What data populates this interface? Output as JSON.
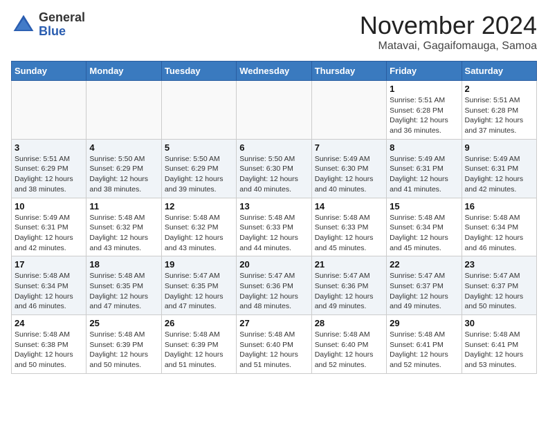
{
  "header": {
    "logo_line1": "General",
    "logo_line2": "Blue",
    "month": "November 2024",
    "location": "Matavai, Gagaifomauga, Samoa"
  },
  "days_of_week": [
    "Sunday",
    "Monday",
    "Tuesday",
    "Wednesday",
    "Thursday",
    "Friday",
    "Saturday"
  ],
  "weeks": [
    [
      {
        "day": "",
        "info": ""
      },
      {
        "day": "",
        "info": ""
      },
      {
        "day": "",
        "info": ""
      },
      {
        "day": "",
        "info": ""
      },
      {
        "day": "",
        "info": ""
      },
      {
        "day": "1",
        "info": "Sunrise: 5:51 AM\nSunset: 6:28 PM\nDaylight: 12 hours and 36 minutes."
      },
      {
        "day": "2",
        "info": "Sunrise: 5:51 AM\nSunset: 6:28 PM\nDaylight: 12 hours and 37 minutes."
      }
    ],
    [
      {
        "day": "3",
        "info": "Sunrise: 5:51 AM\nSunset: 6:29 PM\nDaylight: 12 hours and 38 minutes."
      },
      {
        "day": "4",
        "info": "Sunrise: 5:50 AM\nSunset: 6:29 PM\nDaylight: 12 hours and 38 minutes."
      },
      {
        "day": "5",
        "info": "Sunrise: 5:50 AM\nSunset: 6:29 PM\nDaylight: 12 hours and 39 minutes."
      },
      {
        "day": "6",
        "info": "Sunrise: 5:50 AM\nSunset: 6:30 PM\nDaylight: 12 hours and 40 minutes."
      },
      {
        "day": "7",
        "info": "Sunrise: 5:49 AM\nSunset: 6:30 PM\nDaylight: 12 hours and 40 minutes."
      },
      {
        "day": "8",
        "info": "Sunrise: 5:49 AM\nSunset: 6:31 PM\nDaylight: 12 hours and 41 minutes."
      },
      {
        "day": "9",
        "info": "Sunrise: 5:49 AM\nSunset: 6:31 PM\nDaylight: 12 hours and 42 minutes."
      }
    ],
    [
      {
        "day": "10",
        "info": "Sunrise: 5:49 AM\nSunset: 6:31 PM\nDaylight: 12 hours and 42 minutes."
      },
      {
        "day": "11",
        "info": "Sunrise: 5:48 AM\nSunset: 6:32 PM\nDaylight: 12 hours and 43 minutes."
      },
      {
        "day": "12",
        "info": "Sunrise: 5:48 AM\nSunset: 6:32 PM\nDaylight: 12 hours and 43 minutes."
      },
      {
        "day": "13",
        "info": "Sunrise: 5:48 AM\nSunset: 6:33 PM\nDaylight: 12 hours and 44 minutes."
      },
      {
        "day": "14",
        "info": "Sunrise: 5:48 AM\nSunset: 6:33 PM\nDaylight: 12 hours and 45 minutes."
      },
      {
        "day": "15",
        "info": "Sunrise: 5:48 AM\nSunset: 6:34 PM\nDaylight: 12 hours and 45 minutes."
      },
      {
        "day": "16",
        "info": "Sunrise: 5:48 AM\nSunset: 6:34 PM\nDaylight: 12 hours and 46 minutes."
      }
    ],
    [
      {
        "day": "17",
        "info": "Sunrise: 5:48 AM\nSunset: 6:34 PM\nDaylight: 12 hours and 46 minutes."
      },
      {
        "day": "18",
        "info": "Sunrise: 5:48 AM\nSunset: 6:35 PM\nDaylight: 12 hours and 47 minutes."
      },
      {
        "day": "19",
        "info": "Sunrise: 5:47 AM\nSunset: 6:35 PM\nDaylight: 12 hours and 47 minutes."
      },
      {
        "day": "20",
        "info": "Sunrise: 5:47 AM\nSunset: 6:36 PM\nDaylight: 12 hours and 48 minutes."
      },
      {
        "day": "21",
        "info": "Sunrise: 5:47 AM\nSunset: 6:36 PM\nDaylight: 12 hours and 49 minutes."
      },
      {
        "day": "22",
        "info": "Sunrise: 5:47 AM\nSunset: 6:37 PM\nDaylight: 12 hours and 49 minutes."
      },
      {
        "day": "23",
        "info": "Sunrise: 5:47 AM\nSunset: 6:37 PM\nDaylight: 12 hours and 50 minutes."
      }
    ],
    [
      {
        "day": "24",
        "info": "Sunrise: 5:48 AM\nSunset: 6:38 PM\nDaylight: 12 hours and 50 minutes."
      },
      {
        "day": "25",
        "info": "Sunrise: 5:48 AM\nSunset: 6:39 PM\nDaylight: 12 hours and 50 minutes."
      },
      {
        "day": "26",
        "info": "Sunrise: 5:48 AM\nSunset: 6:39 PM\nDaylight: 12 hours and 51 minutes."
      },
      {
        "day": "27",
        "info": "Sunrise: 5:48 AM\nSunset: 6:40 PM\nDaylight: 12 hours and 51 minutes."
      },
      {
        "day": "28",
        "info": "Sunrise: 5:48 AM\nSunset: 6:40 PM\nDaylight: 12 hours and 52 minutes."
      },
      {
        "day": "29",
        "info": "Sunrise: 5:48 AM\nSunset: 6:41 PM\nDaylight: 12 hours and 52 minutes."
      },
      {
        "day": "30",
        "info": "Sunrise: 5:48 AM\nSunset: 6:41 PM\nDaylight: 12 hours and 53 minutes."
      }
    ]
  ]
}
